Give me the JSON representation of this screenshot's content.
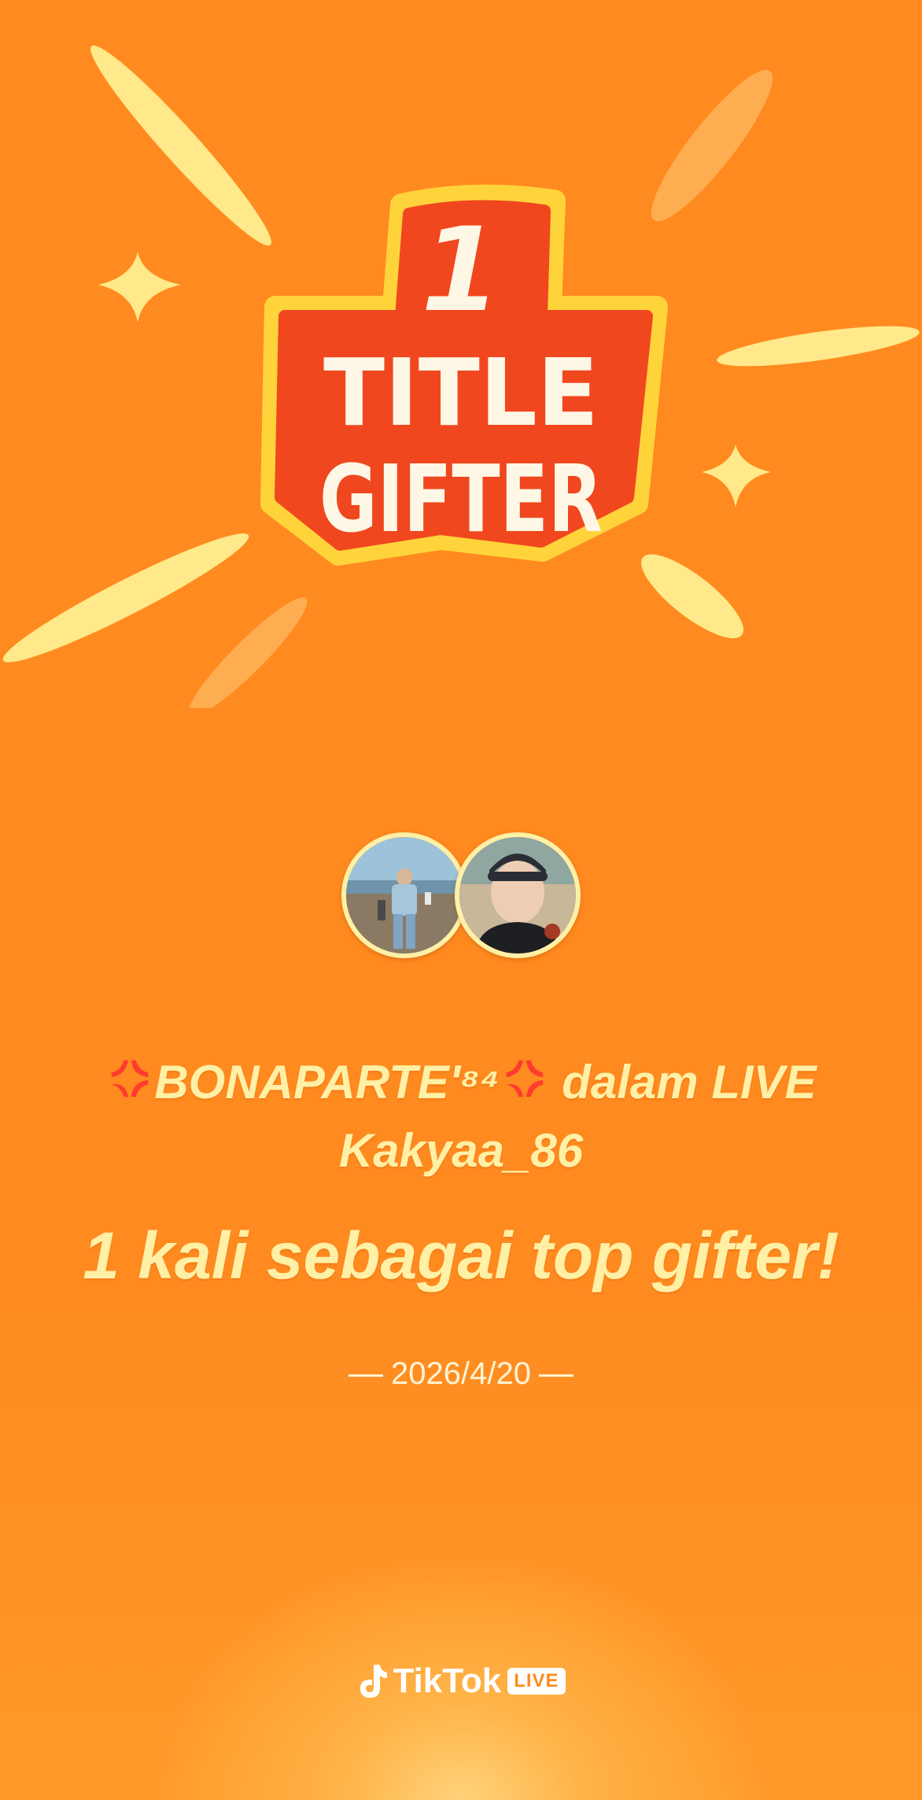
{
  "badge": {
    "rank": "1",
    "line1": "TITLE",
    "line2": "GIFTER"
  },
  "gifter": {
    "name": "BONAPARTE'⁸⁴",
    "name_emoji": "anger-symbol-icon",
    "connector": "dalam LIVE",
    "host": "Kakyaa_86"
  },
  "headline": "1 kali sebagai top gifter!",
  "date": "2026/4/20",
  "brand": {
    "name": "TikTok",
    "live_label": "LIVE",
    "icon": "tiktok-note-icon"
  },
  "colors": {
    "background": "#ff8a1f",
    "text": "#fff0a6",
    "badge_red": "#f0471f",
    "badge_yellow": "#ffd43b"
  }
}
